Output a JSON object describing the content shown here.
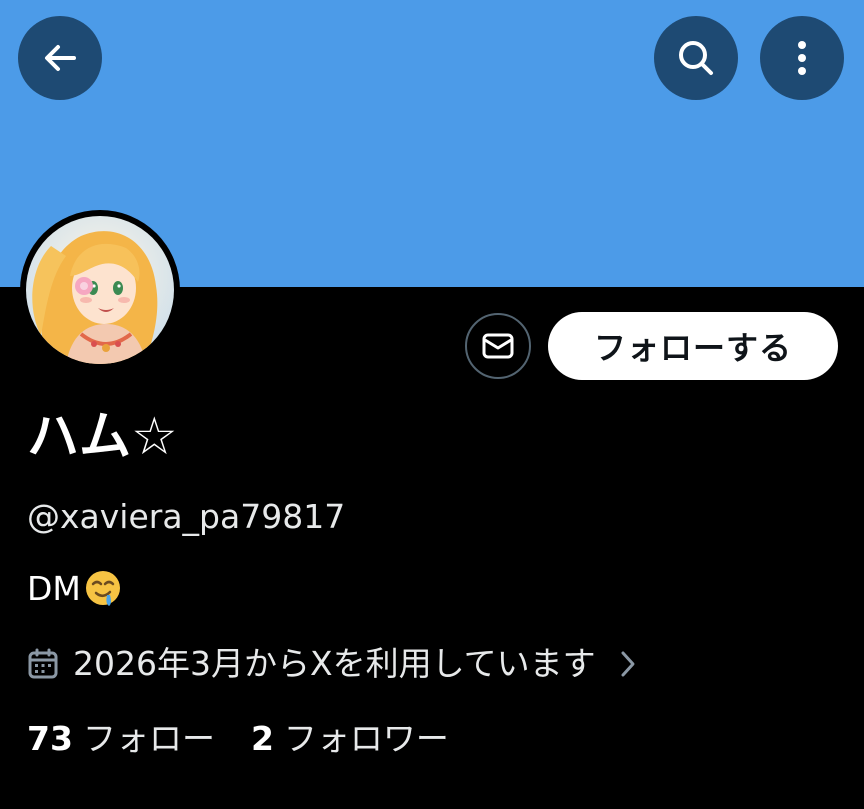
{
  "banner": {
    "color": "#4c9be8"
  },
  "header_buttons": {
    "back_icon": "arrow-left-icon",
    "search_icon": "search-icon",
    "more_icon": "more-vertical-icon",
    "button_bg": "#1e4a73"
  },
  "profile": {
    "avatar_icon": "avatar-illustration",
    "display_name": "ハム☆",
    "handle": "@xaviera_pa79817",
    "bio_text": "DM",
    "bio_emoji": "drooling-face-emoji",
    "joined_text": "2026年3月からXを利用しています",
    "joined_icon": "calendar-icon",
    "joined_chevron": "chevron-right-icon"
  },
  "actions": {
    "dm_icon": "mail-icon",
    "follow_label": "フォローする"
  },
  "stats": {
    "following_count": "73",
    "following_label": "フォロー",
    "followers_count": "2",
    "followers_label": "フォロワー"
  }
}
